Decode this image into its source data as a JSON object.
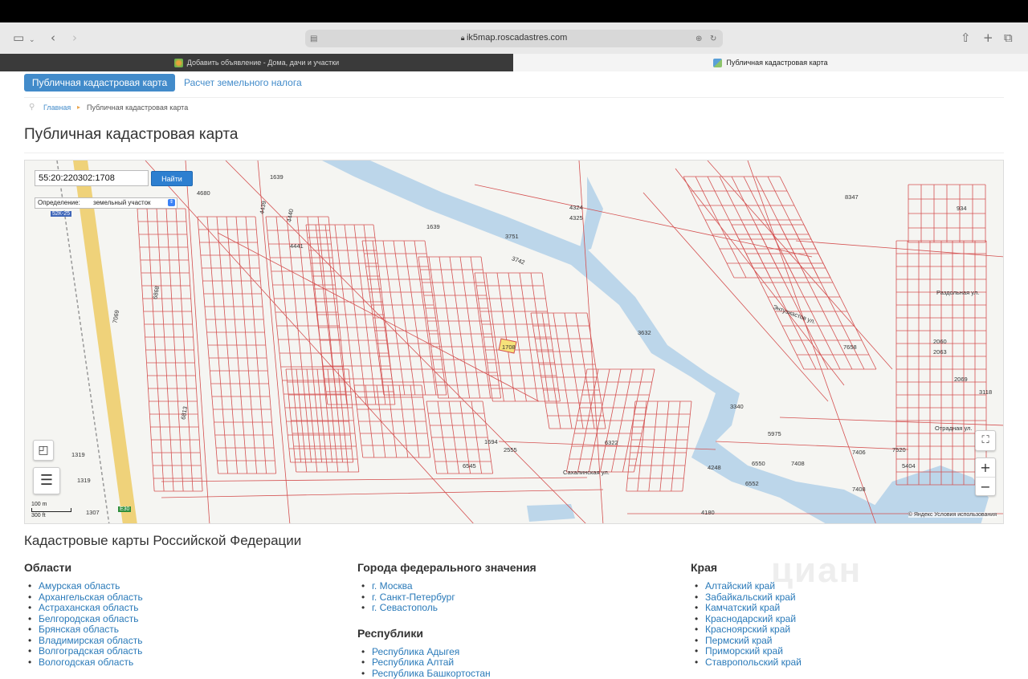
{
  "browser": {
    "url": "ik5map.roscadastres.com",
    "tabs": [
      {
        "title": "Добавить объявление - Дома, дачи и участки",
        "active": false
      },
      {
        "title": "Публичная кадастровая карта",
        "active": true
      }
    ]
  },
  "nav": {
    "items": [
      {
        "label": "Публичная кадастровая карта",
        "active": true
      },
      {
        "label": "Расчет земельного налога",
        "active": false
      }
    ]
  },
  "breadcrumb": {
    "home": "Главная",
    "current": "Публичная кадастровая карта"
  },
  "page_title": "Публичная кадастровая карта",
  "map": {
    "search_value": "55:20:220302:1708",
    "search_button": "Найти",
    "definition_label": "Определение:",
    "definition_value": "земельный участок",
    "road_badge": "52К-25",
    "highway_badge": "E30",
    "scale_m": "100 m",
    "scale_ft": "300 ft",
    "attribution": "© Яндекс Условия использования",
    "colors": {
      "parcel_line": "#d45050",
      "water": "#bcd6ea",
      "road": "#e9c767",
      "selected": "#f6e27a"
    },
    "labels": [
      {
        "t": "1639"
      },
      {
        "t": "4680"
      },
      {
        "t": "4439"
      },
      {
        "t": "4440"
      },
      {
        "t": "4441"
      },
      {
        "t": "1639"
      },
      {
        "t": "3751"
      },
      {
        "t": "3742"
      },
      {
        "t": "8347"
      },
      {
        "t": "934"
      },
      {
        "t": "4324"
      },
      {
        "t": "4325"
      },
      {
        "t": "3632"
      },
      {
        "t": "7658"
      },
      {
        "t": "3340"
      },
      {
        "t": "5975"
      },
      {
        "t": "7408"
      },
      {
        "t": "7406"
      },
      {
        "t": "7408"
      },
      {
        "t": "6550"
      },
      {
        "t": "6552"
      },
      {
        "t": "4248"
      },
      {
        "t": "4180"
      },
      {
        "t": "1319"
      },
      {
        "t": "1319"
      },
      {
        "t": "1307"
      },
      {
        "t": "6813"
      },
      {
        "t": "7069"
      },
      {
        "t": "6868"
      },
      {
        "t": "1708"
      },
      {
        "t": "2060"
      },
      {
        "t": "2063"
      },
      {
        "t": "2069"
      },
      {
        "t": "3118"
      },
      {
        "t": "5404"
      },
      {
        "t": "7520"
      },
      {
        "t": "6322"
      },
      {
        "t": "2555"
      },
      {
        "t": "1694"
      },
      {
        "t": "6545"
      },
      {
        "t": "Сахалинская ул."
      },
      {
        "t": "Энтузиастов ул."
      },
      {
        "t": "Раздольная ул."
      },
      {
        "t": "Отрадная ул."
      }
    ]
  },
  "regions": {
    "title": "Кадастровые карты Российской Федерации",
    "oblasti": {
      "heading": "Области",
      "items": [
        "Амурская область",
        "Архангельская область",
        "Астраханская область",
        "Белгородская область",
        "Брянская область",
        "Владимирская область",
        "Волгоградская область",
        "Вологодская область"
      ]
    },
    "cities": {
      "heading": "Города федерального значения",
      "items": [
        "г. Москва",
        "г. Санкт-Петербург",
        "г. Севастополь"
      ]
    },
    "republics": {
      "heading": "Республики",
      "items": [
        "Республика Адыгея",
        "Республика Алтай",
        "Республика Башкортостан"
      ]
    },
    "krai": {
      "heading": "Края",
      "items": [
        "Алтайский край",
        "Забайкальский край",
        "Камчатский край",
        "Краснодарский край",
        "Красноярский край",
        "Пермский край",
        "Приморский край",
        "Ставропольский край"
      ]
    }
  },
  "watermark": "циан"
}
